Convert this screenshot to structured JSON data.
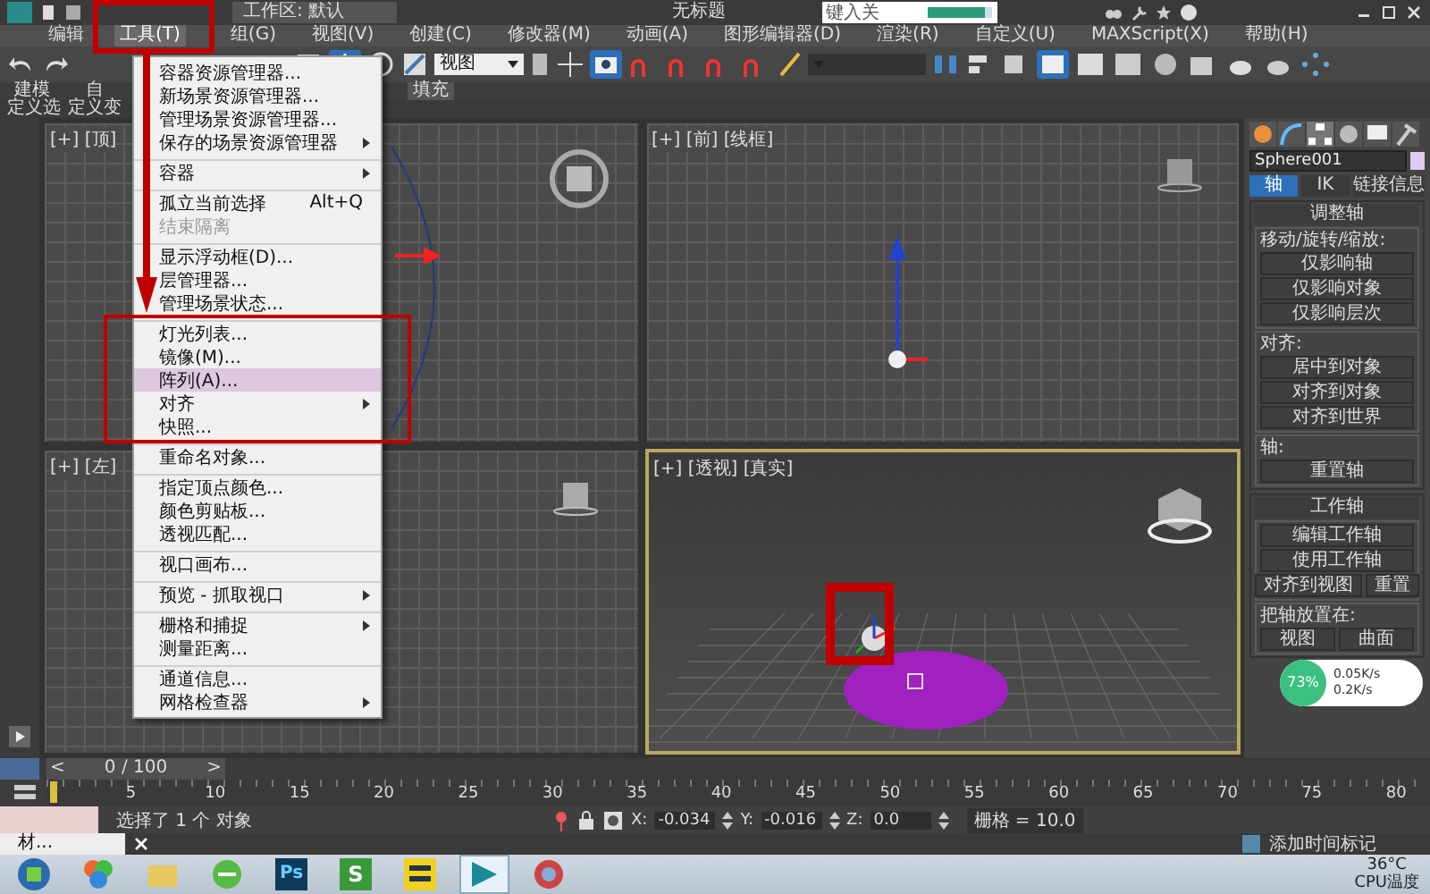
{
  "title_bar": {
    "workspace": "工作区: 默认",
    "title": "无标题",
    "search_placeholder": "键入关",
    "progress": {
      "level": 0.9
    }
  },
  "menu_bar": [
    {
      "label": "编辑",
      "selected": false
    },
    {
      "label": "工具(T)",
      "selected": true
    },
    {
      "label": "组(G)",
      "selected": false
    },
    {
      "label": "视图(V)",
      "selected": false
    },
    {
      "label": "创建(C)",
      "selected": false
    },
    {
      "label": "修改器(M)",
      "selected": false
    },
    {
      "label": "动画(A)",
      "selected": false
    },
    {
      "label": "图形编辑器(D)",
      "selected": false
    },
    {
      "label": "渲染(R)",
      "selected": false
    },
    {
      "label": "自定义(U)",
      "selected": false
    },
    {
      "label": "MAXScript(X)",
      "selected": false
    },
    {
      "label": "帮助(H)",
      "selected": false
    }
  ],
  "toolbar": {
    "view_dropdown": "视图"
  },
  "ribbon": {
    "tabs": [
      {
        "label": "建模",
        "selected": false
      },
      {
        "label": "自",
        "selected": false
      },
      {
        "label": "填充",
        "selected": true
      }
    ],
    "row2": [
      "定义选",
      "定义变"
    ]
  },
  "tools_menu": [
    {
      "label": "容器资源管理器...",
      "submenu": false,
      "disabled": false,
      "selected": false,
      "group_start": false
    },
    {
      "label": "新场景资源管理器...",
      "submenu": false,
      "disabled": false,
      "selected": false,
      "group_start": false
    },
    {
      "label": "管理场景资源管理器...",
      "submenu": false,
      "disabled": false,
      "selected": false,
      "group_start": false
    },
    {
      "label": "保存的场景资源管理器",
      "submenu": true,
      "disabled": false,
      "selected": false,
      "group_start": false
    },
    {
      "label": "容器",
      "submenu": true,
      "disabled": false,
      "selected": false,
      "group_start": true
    },
    {
      "label": "孤立当前选择",
      "shortcut": "Alt+Q",
      "submenu": false,
      "disabled": false,
      "selected": false,
      "group_start": true
    },
    {
      "label": "结束隔离",
      "submenu": false,
      "disabled": true,
      "selected": false,
      "group_start": false
    },
    {
      "label": "显示浮动框(D)...",
      "submenu": false,
      "disabled": false,
      "selected": false,
      "group_start": true
    },
    {
      "label": "层管理器...",
      "submenu": false,
      "disabled": false,
      "selected": false,
      "group_start": false
    },
    {
      "label": "管理场景状态...",
      "submenu": false,
      "disabled": false,
      "selected": false,
      "group_start": false
    },
    {
      "label": "灯光列表...",
      "submenu": false,
      "disabled": false,
      "selected": false,
      "group_start": true
    },
    {
      "label": "镜像(M)...",
      "submenu": false,
      "disabled": false,
      "selected": false,
      "group_start": false
    },
    {
      "label": "阵列(A)...",
      "submenu": false,
      "disabled": false,
      "selected": true,
      "group_start": false
    },
    {
      "label": "对齐",
      "submenu": true,
      "disabled": false,
      "selected": false,
      "group_start": false
    },
    {
      "label": "快照...",
      "submenu": false,
      "disabled": false,
      "selected": false,
      "group_start": false
    },
    {
      "label": "重命名对象...",
      "submenu": false,
      "disabled": false,
      "selected": false,
      "group_start": true
    },
    {
      "label": "指定顶点颜色...",
      "submenu": false,
      "disabled": false,
      "selected": false,
      "group_start": true
    },
    {
      "label": "颜色剪贴板...",
      "submenu": false,
      "disabled": false,
      "selected": false,
      "group_start": false
    },
    {
      "label": "透视匹配...",
      "submenu": false,
      "disabled": false,
      "selected": false,
      "group_start": false
    },
    {
      "label": "视口画布...",
      "submenu": false,
      "disabled": false,
      "selected": false,
      "group_start": true
    },
    {
      "label": "预览 - 抓取视口",
      "submenu": true,
      "disabled": false,
      "selected": false,
      "group_start": true
    },
    {
      "label": "栅格和捕捉",
      "submenu": true,
      "disabled": false,
      "selected": false,
      "group_start": true
    },
    {
      "label": "测量距离...",
      "submenu": false,
      "disabled": false,
      "selected": false,
      "group_start": false
    },
    {
      "label": "通道信息...",
      "submenu": false,
      "disabled": false,
      "selected": false,
      "group_start": true
    },
    {
      "label": "网格检查器",
      "submenu": true,
      "disabled": false,
      "selected": false,
      "group_start": false
    }
  ],
  "viewports": [
    {
      "label": "[+] [顶]",
      "active": false,
      "kind": "top"
    },
    {
      "label": "[+] [前] [线框]",
      "active": false,
      "kind": "front"
    },
    {
      "label": "[+] [左]",
      "active": false,
      "kind": "left"
    },
    {
      "label": "[+] [透视] [真实]",
      "active": true,
      "kind": "perspective"
    }
  ],
  "command_panel": {
    "object_name": "Sphere001",
    "tabs": [
      {
        "label": "轴",
        "selected": true
      },
      {
        "label": "IK",
        "selected": false
      },
      {
        "label": "链接信息",
        "selected": false
      }
    ],
    "rollouts": [
      {
        "title": "调整轴",
        "groups": [
          {
            "label": "移动/旋转/缩放:",
            "rows": [
              [
                "仅影响轴"
              ],
              [
                "仅影响对象"
              ],
              [
                "仅影响层次"
              ]
            ]
          },
          {
            "label": "对齐:",
            "rows": [
              [
                "居中到对象"
              ],
              [
                "对齐到对象"
              ],
              [
                "对齐到世界"
              ]
            ]
          },
          {
            "label": "轴:",
            "rows": [
              [
                "重置轴"
              ]
            ]
          }
        ]
      },
      {
        "title": "工作轴",
        "groups": [
          {
            "rows": [
              [
                "编辑工作轴"
              ],
              [
                "使用工作轴"
              ],
              [
                "对齐到视图",
                "重置"
              ]
            ]
          },
          {
            "label": "把轴放置在:",
            "rows": [
              [
                "视图",
                "曲面"
              ]
            ]
          }
        ]
      }
    ]
  },
  "network_widget": {
    "percent": "73%",
    "up": "0.05K/s",
    "down": "0.2K/s"
  },
  "timeline": {
    "frame": "0 / 100",
    "prev": "<",
    "next": ">",
    "level": 0,
    "ticks": [
      "5",
      "10",
      "15",
      "20",
      "25",
      "30",
      "35",
      "40",
      "45",
      "50",
      "55",
      "60",
      "65",
      "70",
      "75",
      "80"
    ]
  },
  "status": {
    "message": "选择了 1 个 对象",
    "coords": [
      {
        "axis": "X:",
        "value": "-0.034"
      },
      {
        "axis": "Y:",
        "value": "-0.016"
      },
      {
        "axis": "Z:",
        "value": "0.0"
      }
    ],
    "grid": "栅格 = 10.0",
    "listener": "材...",
    "time_tag": "添加时间标记"
  },
  "taskbar": {
    "apps": [
      {
        "kind": "start",
        "selected": false
      },
      {
        "kind": "palette",
        "selected": false
      },
      {
        "kind": "folder",
        "selected": false
      },
      {
        "kind": "sync",
        "selected": false
      },
      {
        "kind": "ps",
        "label": "Ps",
        "selected": false
      },
      {
        "kind": "letter",
        "label": "S",
        "selected": false
      },
      {
        "kind": "yellow",
        "selected": false
      },
      {
        "kind": "max",
        "selected": true
      },
      {
        "kind": "browser",
        "selected": false
      }
    ],
    "tray": {
      "temp": "36°C",
      "cpu": "CPU温度"
    }
  }
}
